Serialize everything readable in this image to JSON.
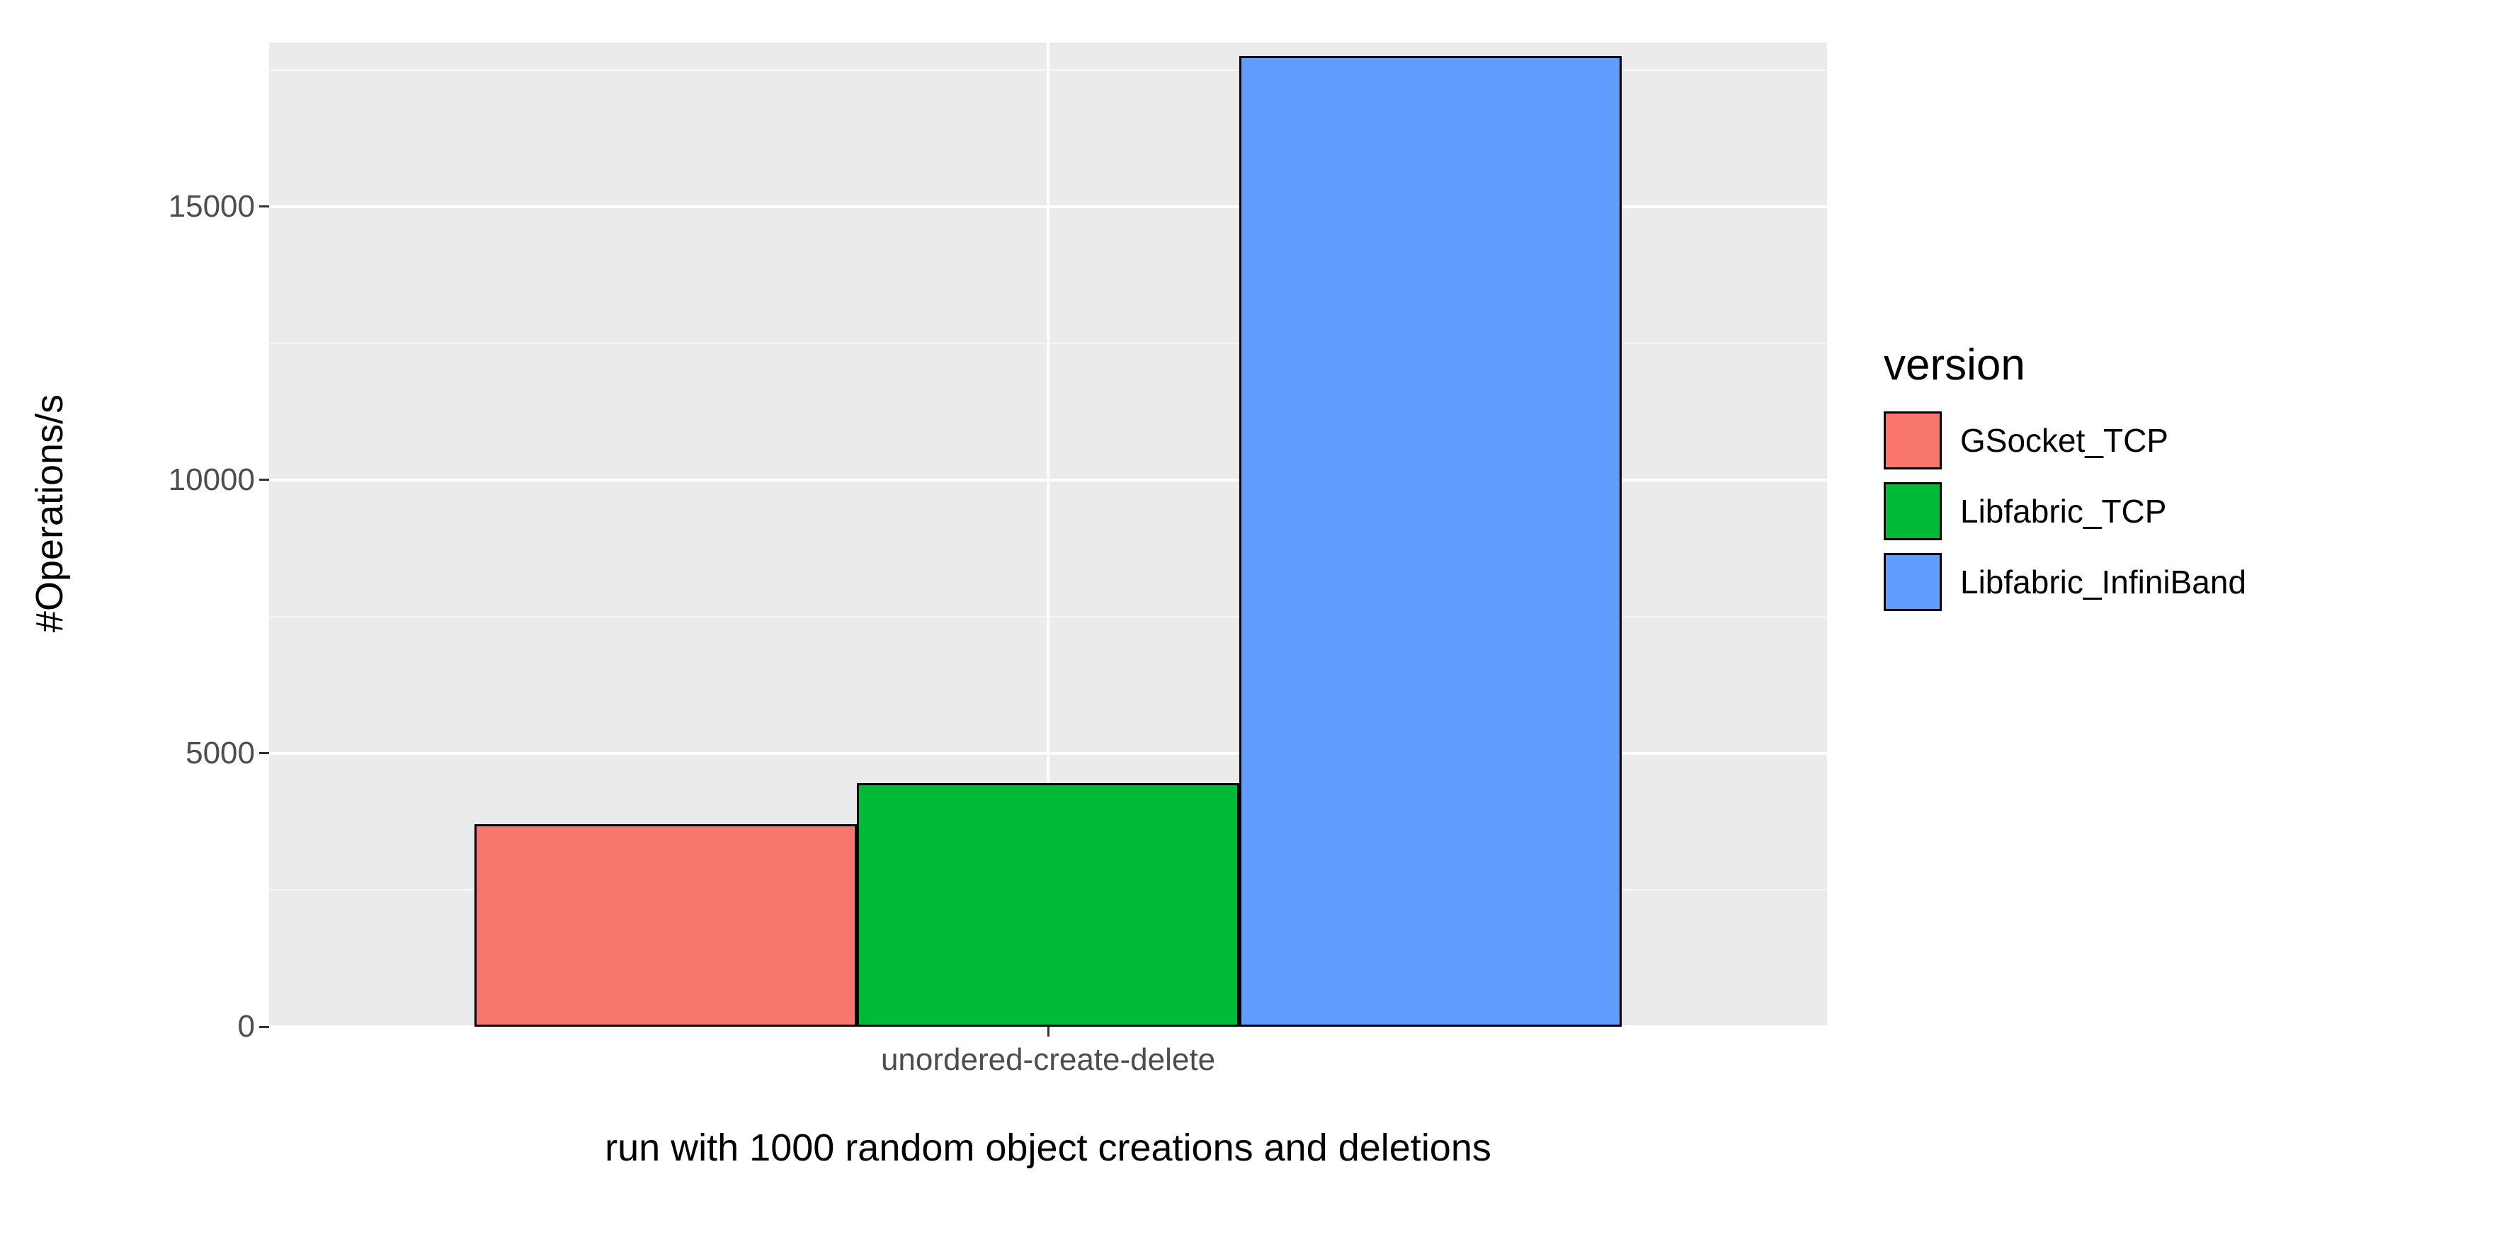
{
  "chart_data": {
    "type": "bar",
    "categories": [
      "unordered-create-delete"
    ],
    "series": [
      {
        "name": "GSocket_TCP",
        "values": [
          3700
        ],
        "color": "#f8766d"
      },
      {
        "name": "Libfabric_TCP",
        "values": [
          4450
        ],
        "color": "#00ba38"
      },
      {
        "name": "Libfabric_InfiniBand",
        "values": [
          17750
        ],
        "color": "#619cff"
      }
    ],
    "ylabel": "#Operations/s",
    "xlabel": "run with 1000 random object creations and deletions",
    "ylim": [
      0,
      18000
    ],
    "yticks": [
      0,
      5000,
      10000,
      15000
    ],
    "yminor": [
      2500,
      7500,
      12500,
      17500
    ],
    "legend_title": "version"
  }
}
